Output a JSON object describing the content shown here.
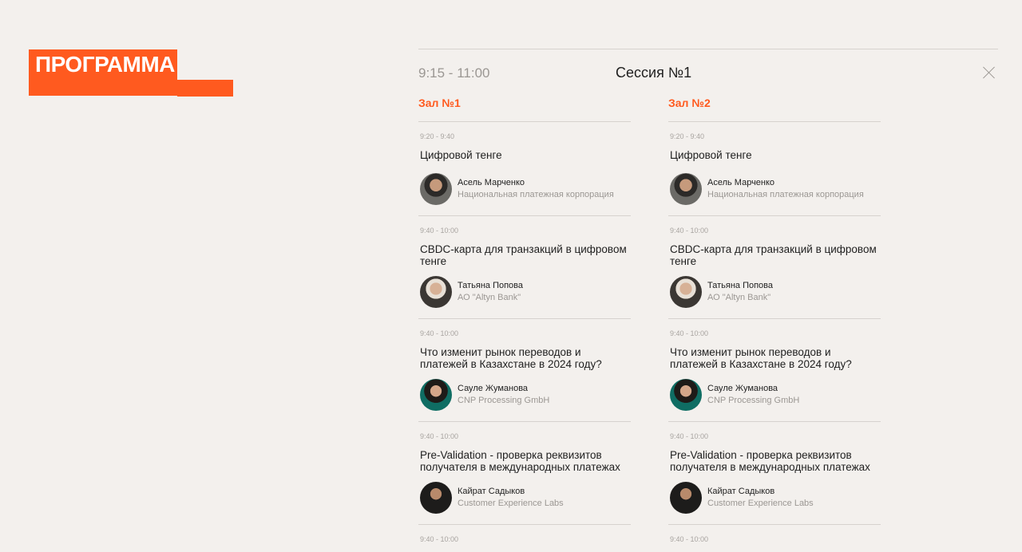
{
  "logo": {
    "text": "ПРОГРАММА"
  },
  "session": {
    "time": "9:15 - 11:00",
    "title": "Сессия №1"
  },
  "halls": [
    {
      "title": "Зал №1",
      "talks": [
        {
          "time": "9:20 - 9:40",
          "title": "Цифровой тенге",
          "speaker": "Асель Марченко",
          "org": "Национальная платежная корпорация"
        },
        {
          "time": "9:40 - 10:00",
          "title": "CBDC-карта для транзакций в цифровом тенге",
          "speaker": "Татьяна Попова",
          "org": "АО \"Altyn Bank\""
        },
        {
          "time": "9:40 - 10:00",
          "title": "Что изменит рынок переводов и платежей в Казахстане в 2024 году?",
          "speaker": "Сауле Жуманова",
          "org": "CNP Processing GmbH"
        },
        {
          "time": "9:40 - 10:00",
          "title": "Pre-Validation - проверка реквизитов получателя в международных платежах",
          "speaker": "Кайрат Садыков",
          "org": "Customer Experience Labs"
        }
      ],
      "next_time": "9:40 - 10:00"
    },
    {
      "title": "Зал №2",
      "talks": [
        {
          "time": "9:20 - 9:40",
          "title": "Цифровой тенге",
          "speaker": "Асель Марченко",
          "org": "Национальная платежная корпорация"
        },
        {
          "time": "9:40 - 10:00",
          "title": "CBDC-карта для транзакций в цифровом тенге",
          "speaker": "Татьяна Попова",
          "org": "АО \"Altyn Bank\""
        },
        {
          "time": "9:40 - 10:00",
          "title": "Что изменит рынок переводов и платежей в Казахстане в 2024 году?",
          "speaker": "Сауле Жуманова",
          "org": "CNP Processing GmbH"
        },
        {
          "time": "9:40 - 10:00",
          "title": "Pre-Validation - проверка реквизитов получателя в международных платежах",
          "speaker": "Кайрат Садыков",
          "org": "Customer Experience Labs"
        }
      ],
      "next_time": "9:40 - 10:00"
    }
  ],
  "colors": {
    "accent": "#ff5a1f",
    "background": "#f3f0ed"
  }
}
